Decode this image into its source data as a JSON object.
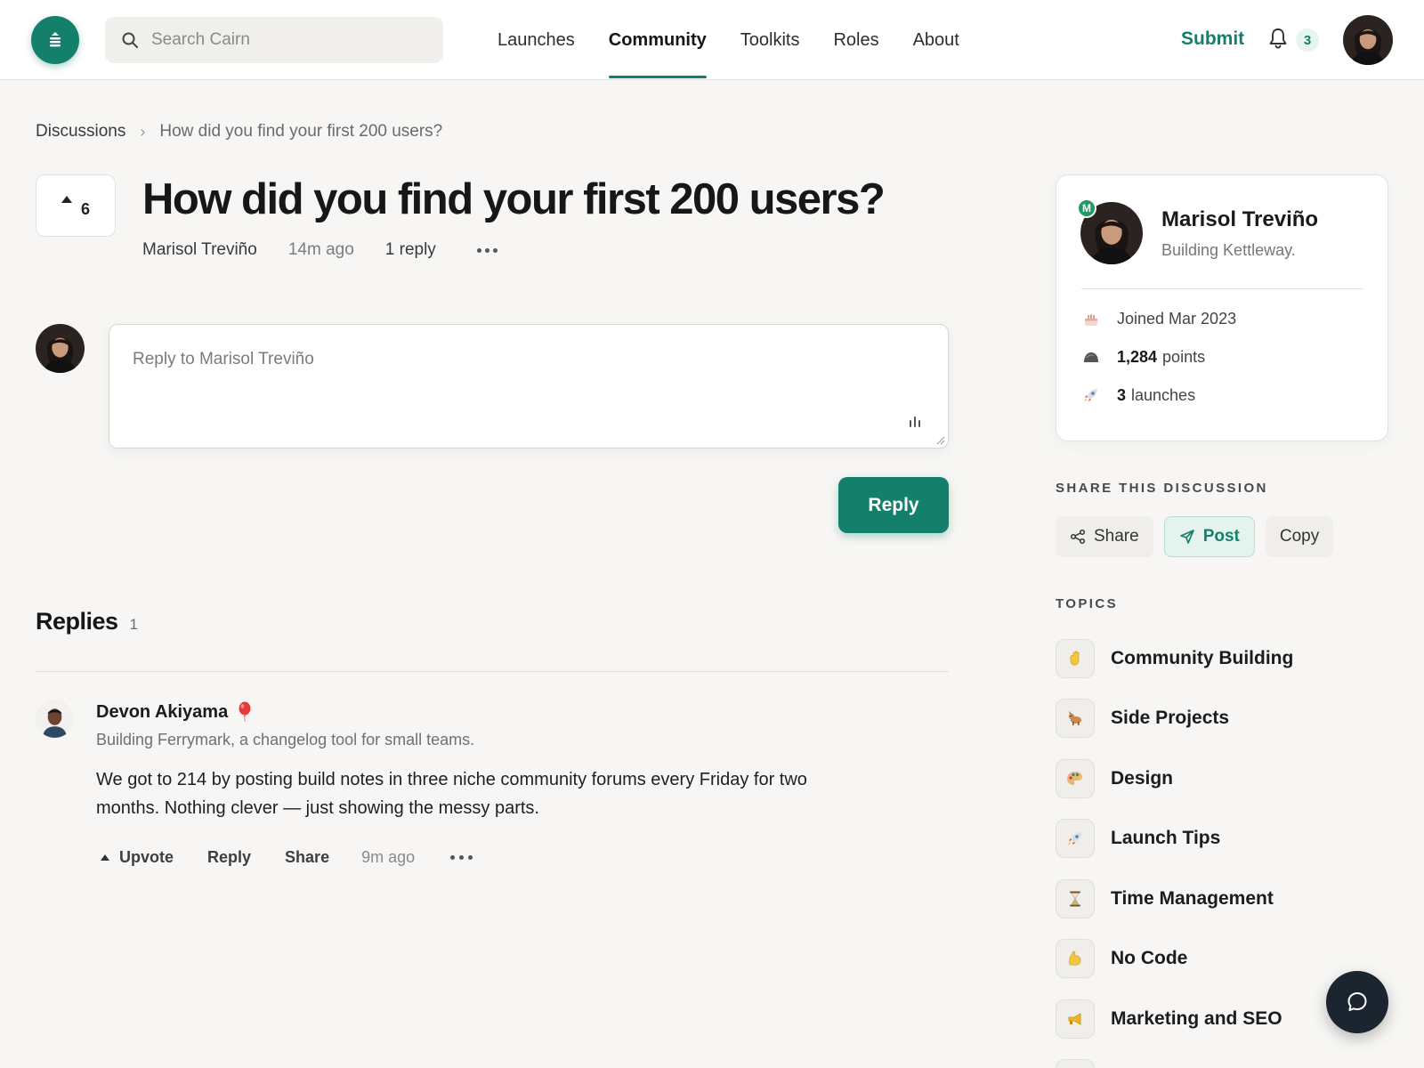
{
  "header": {
    "search_placeholder": "Search Cairn",
    "nav": [
      {
        "label": "Launches",
        "active": false
      },
      {
        "label": "Community",
        "active": true
      },
      {
        "label": "Toolkits",
        "active": false
      },
      {
        "label": "Roles",
        "active": false
      },
      {
        "label": "About",
        "active": false
      }
    ],
    "submit_label": "Submit",
    "notification_count": "3",
    "accent_color": "#14806c"
  },
  "breadcrumb": {
    "parent": "Discussions",
    "current": "How did you find your first 200 users?"
  },
  "post": {
    "votes": "6",
    "title": "How did you find your first 200 users?",
    "author": "Marisol Treviño",
    "time": "14m ago",
    "replies_text": "1 reply"
  },
  "composer": {
    "placeholder": "Reply to Marisol Treviño",
    "button_label": "Reply"
  },
  "replies": {
    "title": "Replies",
    "count": "1",
    "items": [
      {
        "author": "Devon Akiyama",
        "badge_icon": "balloon-icon",
        "bio": "Building Ferrymark, a changelog tool for small teams.",
        "body": "We got to 214 by posting build notes in three niche community forums every Friday for two months. Nothing clever — just showing the messy parts.",
        "actions": {
          "upvote": "Upvote",
          "reply": "Reply",
          "share": "Share"
        },
        "time": "9m ago"
      }
    ]
  },
  "profile": {
    "badge_letter": "M",
    "name": "Marisol Treviño",
    "bio": "Building Kettleway.",
    "joined": "Joined Mar 2023",
    "points_value": "1,284",
    "points_label": "points",
    "launches_value": "3",
    "launches_label": "launches"
  },
  "share": {
    "label": "SHARE THIS DISCUSSION",
    "buttons": [
      "Share",
      "Post",
      "Copy"
    ]
  },
  "topics": {
    "label": "TOPICS",
    "items": [
      {
        "label": "Community Building",
        "icon": "waving-hand-icon"
      },
      {
        "label": "Side Projects",
        "icon": "dog-icon"
      },
      {
        "label": "Design",
        "icon": "palette-icon"
      },
      {
        "label": "Launch Tips",
        "icon": "rocket-icon"
      },
      {
        "label": "Time Management",
        "icon": "hourglass-icon"
      },
      {
        "label": "No Code",
        "icon": "flexed-arm-icon"
      },
      {
        "label": "Marketing and SEO",
        "icon": "megaphone-icon"
      }
    ]
  }
}
